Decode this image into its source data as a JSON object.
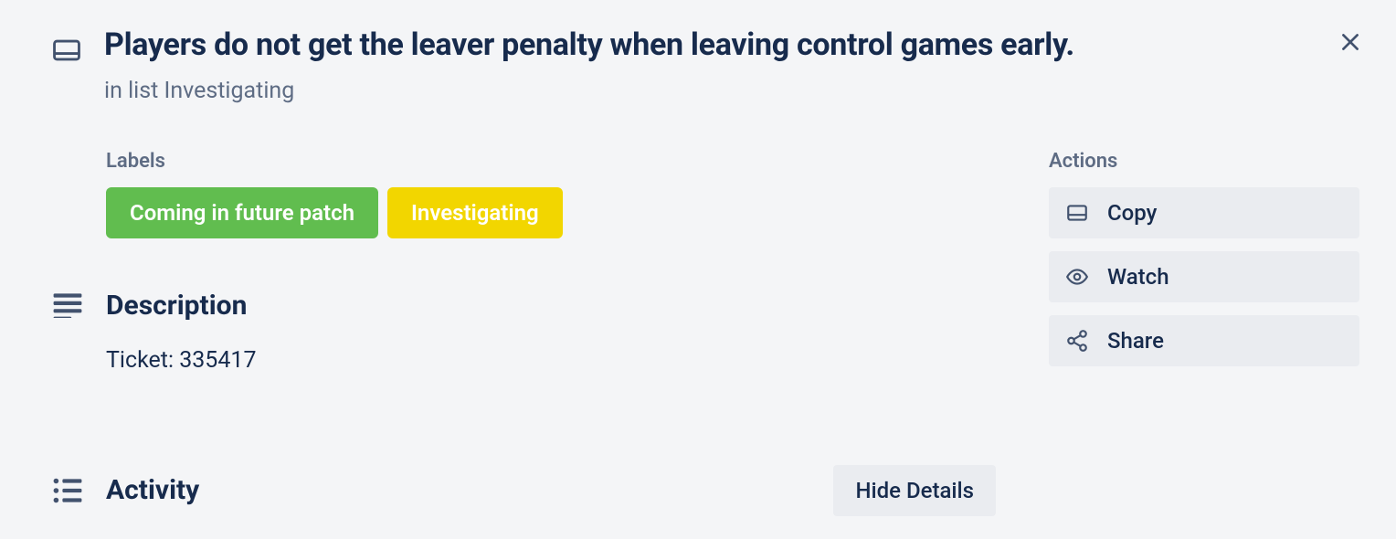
{
  "card": {
    "title": "Players do not get the leaver penalty when leaving control games early.",
    "list_prefix": "in list ",
    "list_name": "Investigating"
  },
  "labels": {
    "heading": "Labels",
    "items": [
      {
        "text": "Coming in future patch",
        "color": "#61bd4f"
      },
      {
        "text": "Investigating",
        "color": "#f2d600"
      }
    ]
  },
  "description": {
    "heading": "Description",
    "body": "Ticket: 335417"
  },
  "activity": {
    "heading": "Activity",
    "hide_details": "Hide Details"
  },
  "actions": {
    "heading": "Actions",
    "copy": "Copy",
    "watch": "Watch",
    "share": "Share"
  }
}
